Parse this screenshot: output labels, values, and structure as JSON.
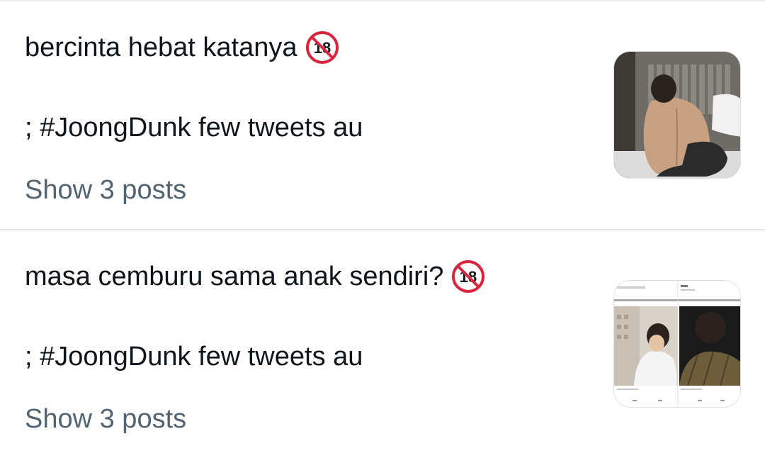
{
  "threads": [
    {
      "title": "bercinta hebat katanya",
      "title_icon": "no-under-18-icon",
      "hashtag_line": "; #JoongDunk few tweets au",
      "show_posts_label": "Show 3 posts",
      "thumbnail": "shirtless-back-photo"
    },
    {
      "title": "masa cemburu sama anak sendiri?",
      "title_icon": "no-under-18-icon",
      "hashtag_line": "; #JoongDunk few tweets au",
      "show_posts_label": "Show 3 posts",
      "thumbnail": "two-photo-collage-screenshot"
    }
  ],
  "colors": {
    "text_primary": "#0f1419",
    "text_secondary": "#536471",
    "divider": "#e3e6e8",
    "badge_red": "#d7263d"
  }
}
